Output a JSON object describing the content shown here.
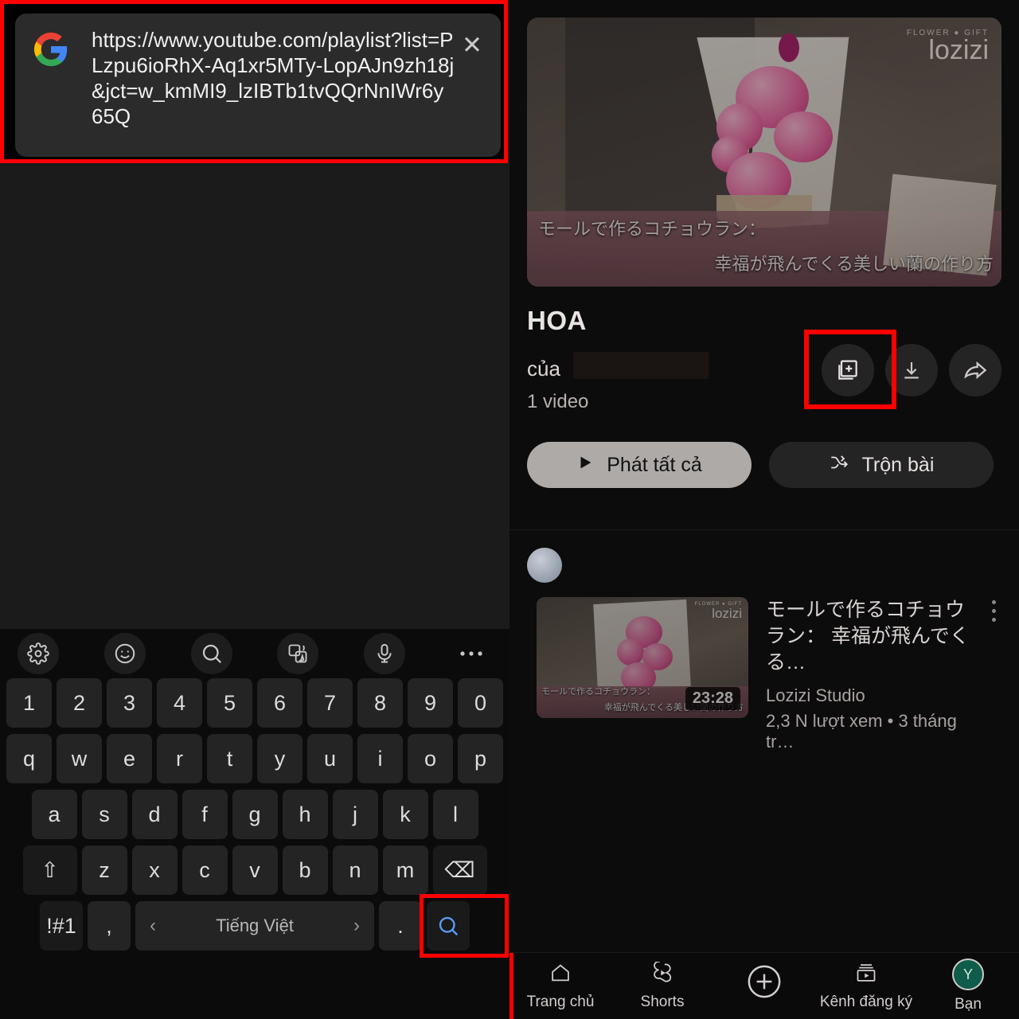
{
  "notification": {
    "app_icon": "google-g-icon",
    "url_text": "https://www.youtube.com/playlist?list=PLzpu6ioRhX-Aq1xr5MTy-LopAJn9zh18j&jct=w_kmMI9_lzIBTb1tvQQrNnIWr6y65Q",
    "close_label": "✕",
    "highlight_color": "#ff0000"
  },
  "keyboard": {
    "toolbar": [
      {
        "icon": "gear-icon"
      },
      {
        "icon": "emoji-icon"
      },
      {
        "icon": "search-icon"
      },
      {
        "icon": "translate-icon"
      },
      {
        "icon": "microphone-icon"
      },
      {
        "icon": "more-horizontal-icon"
      }
    ],
    "row_numbers": [
      "1",
      "2",
      "3",
      "4",
      "5",
      "6",
      "7",
      "8",
      "9",
      "0"
    ],
    "row_top": [
      "q",
      "w",
      "e",
      "r",
      "t",
      "y",
      "u",
      "i",
      "o",
      "p"
    ],
    "row_home": [
      "a",
      "s",
      "d",
      "f",
      "g",
      "h",
      "j",
      "k",
      "l"
    ],
    "row_bottom": [
      "z",
      "x",
      "c",
      "v",
      "b",
      "n",
      "m"
    ],
    "shift_label": "⇧",
    "backspace_label": "⌫",
    "symbols_label": "!#1",
    "comma_label": ",",
    "period_label": ".",
    "space_language": "Tiếng Việt",
    "space_prev": "‹",
    "space_next": "›",
    "enter_icon": "search-icon",
    "enter_icon_color": "#5b9bf8",
    "enter_highlight_color": "#ff0000"
  },
  "playlist": {
    "hero": {
      "logo_tagline": "FLOWER ● GIFT",
      "logo_name": "lozizi",
      "subtitle_line1": "モールで作るコチョウラン：",
      "subtitle_line2": "幸福が飛んでくる美しい蘭の作り方"
    },
    "title": "HOA",
    "owner_label": "của",
    "video_count": "1 video",
    "actions": [
      {
        "icon": "library-add-icon",
        "name": "save-to-library-button",
        "highlighted": true
      },
      {
        "icon": "download-icon",
        "name": "download-button",
        "highlighted": false
      },
      {
        "icon": "share-icon",
        "name": "share-button",
        "highlighted": false
      }
    ],
    "play_all_label": "Phát tất cả",
    "shuffle_label": "Trộn bài",
    "videos": [
      {
        "title": "モールで作るコチョウラン： 幸福が飛んでくる…",
        "channel": "Lozizi Studio",
        "stats": "2,3 N lượt xem • 3 tháng tr…",
        "duration": "23:28",
        "thumb_logo_tagline": "FLOWER ● GIFT",
        "thumb_logo_name": "lozizi",
        "thumb_sub1": "モールで作るコチョウラン：",
        "thumb_sub2": "幸福が飛んでくる美しい蘭の作り方"
      }
    ]
  },
  "bottom_nav": [
    {
      "icon": "home-icon",
      "label": "Trang chủ"
    },
    {
      "icon": "shorts-icon",
      "label": "Shorts"
    },
    {
      "icon": "plus-circle-icon",
      "label": ""
    },
    {
      "icon": "subscriptions-icon",
      "label": "Kênh đăng ký"
    },
    {
      "icon": "account-avatar",
      "label": "Bạn",
      "avatar_letter": "Y",
      "avatar_color": "#0f5c4a"
    }
  ]
}
